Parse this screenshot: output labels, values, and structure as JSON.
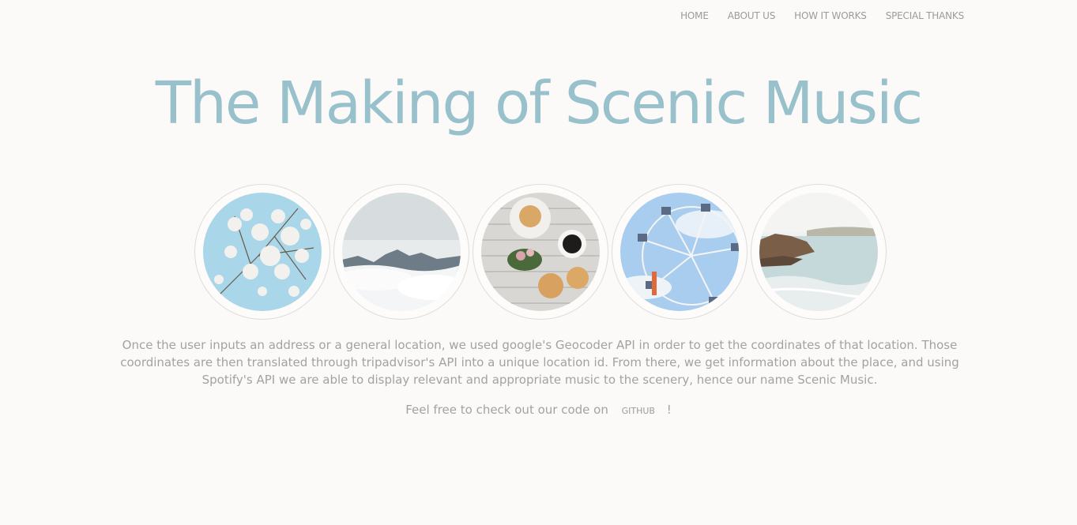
{
  "nav": {
    "home": "HOME",
    "about": "ABOUT US",
    "how": "HOW IT WORKS",
    "thanks": "SPECIAL THANKS"
  },
  "title": "The Making of Scenic Music",
  "images": [
    {
      "name": "cherry-blossom-photo"
    },
    {
      "name": "mountains-clouds-photo"
    },
    {
      "name": "coffee-pastries-photo"
    },
    {
      "name": "ferris-wheel-photo"
    },
    {
      "name": "coastline-photo"
    }
  ],
  "description": "Once the user inputs an address or a general location, we used google's Geocoder API in order to get the coordinates of that location. Those coordinates are then translated through tripadvisor's API into a unique location id. From there, we get information about the place, and using Spotify's API we are able to display relevant and appropriate music to the scenery, hence our name Scenic Music.",
  "cta": {
    "text": "Feel free to check out our code on",
    "link": "GITHUB",
    "suffix": "!"
  },
  "colors": {
    "title": "#98c1cc",
    "background": "#fbfaf8",
    "text": "#a2a2a2"
  }
}
